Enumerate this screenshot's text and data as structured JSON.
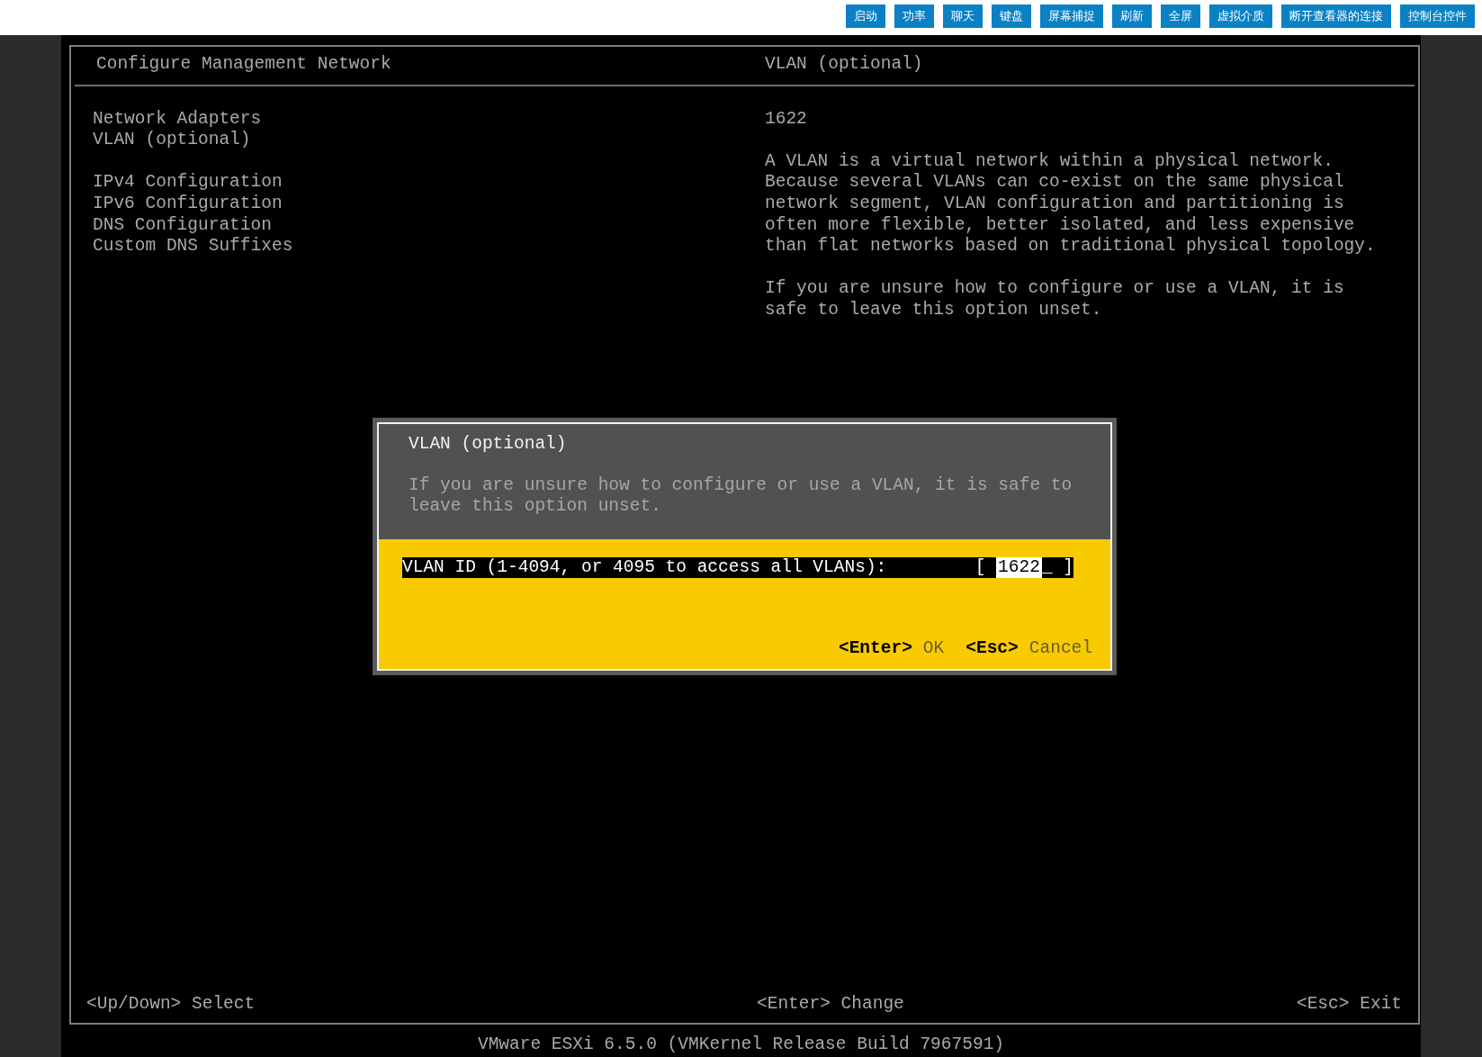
{
  "toolbar": {
    "buttons": [
      "启动",
      "功率",
      "聊天",
      "键盘",
      "屏幕捕捉",
      "刷新",
      "全屏",
      "虚拟介质",
      "断开查看器的连接",
      "控制台控件"
    ]
  },
  "console": {
    "title": "Configure Management Network",
    "menu_groups": [
      [
        "Network Adapters",
        "VLAN (optional)"
      ],
      [
        "IPv4 Configuration",
        "IPv6 Configuration",
        "DNS Configuration",
        "Custom DNS Suffixes"
      ]
    ],
    "detail": {
      "title": "VLAN (optional)",
      "value": "1622",
      "paragraphs": [
        "A VLAN is a virtual network within a physical network. Because several VLANs can co-exist on the same physical network segment, VLAN configuration and partitioning is often more flexible, better isolated, and less expensive than flat networks based on traditional physical topology.",
        "If you are unsure how to configure or use a VLAN, it is safe to leave this option unset."
      ]
    },
    "dialog": {
      "title": "VLAN (optional)",
      "message": "If you are unsure how to configure or use a VLAN, it is safe to leave this option unset.",
      "field": {
        "label": "VLAN ID (1-4094, or 4095 to access all VLANs):",
        "open_bracket": "[",
        "value": "1622",
        "cursor": "_",
        "close_bracket": "]"
      },
      "actions": [
        {
          "key": "<Enter>",
          "label": "OK"
        },
        {
          "key": "<Esc>",
          "label": "Cancel"
        }
      ]
    },
    "hints": [
      {
        "key": "<Up/Down>",
        "action": "Select"
      },
      {
        "key": "<Enter>",
        "action": "Change"
      },
      {
        "key": "<Esc>",
        "action": "Exit"
      }
    ],
    "status": "VMware ESXi 6.5.0 (VMKernel Release Build 7967591)"
  }
}
